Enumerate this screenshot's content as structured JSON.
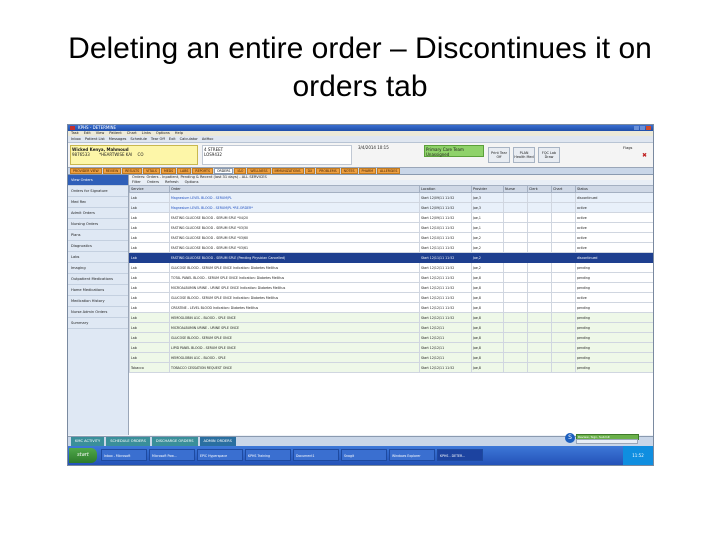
{
  "slide": {
    "title_line1": "Deleting an entire order – Discontinues it on",
    "title_line2": "orders tab"
  },
  "app": {
    "window_title": "KPHS - DETERMINE",
    "menu": [
      "Task",
      "Edit",
      "View",
      "Patient",
      "Chart",
      "Links",
      "Options",
      "Help"
    ],
    "toolbar": [
      "Inbox",
      "Patient List",
      "Messages",
      "Schedule",
      "Tear Off",
      "Exit",
      "Calculator",
      "AdHoc"
    ]
  },
  "patient": {
    "name": "Wicked Kenya, Mahmoud",
    "mrn": "9876533",
    "dob": "*HEARTWISE KAI",
    "age": "CO",
    "location": "4 STREET",
    "encounter": "LOS9432",
    "datetime": "3/4/2014 10:15",
    "allergy_alert": "Primary Care Team Unassigned",
    "buttons": [
      "Print Tear Off",
      "PLAN Health Med",
      "FQC Lab Draw"
    ],
    "flags_label": "Flags"
  },
  "nav_tabs": [
    "PROVIDER VIEW",
    "REVIEW",
    "RESULTS",
    "VITALS",
    "MEDS",
    "LABS",
    "REPORTS",
    "ORDERS",
    "I&O",
    "WELLNESS",
    "IMMUNIZATIONS",
    "DX",
    "PROBLEMS",
    "NOTES",
    "PHARM",
    "ALLERGIES"
  ],
  "active_tab": "ORDERS",
  "sidebar": [
    "View Orders",
    "Orders for Signature",
    "Med Rec",
    "Admit Orders",
    "Nursing Orders",
    "Plans",
    "Diagnostics",
    "Labs",
    "Imaging",
    "Outpatient Medications",
    "Home Medications",
    "Medication History",
    "Nurse Admin Orders",
    "Summary"
  ],
  "sidebar_selected": 0,
  "orders": {
    "filter_text": "Orders: Orders - Inpatient, Pending & Recent (last 31 days) - ALL SERVICES",
    "subtools": [
      "Filter",
      "Orders",
      "Refresh",
      "Options"
    ],
    "columns": [
      "Service",
      "Order",
      "Location",
      "Provider",
      "Nurse",
      "Clerk",
      "Chart",
      "Status"
    ],
    "rows": [
      {
        "service": "Lab",
        "order": "Magnesium LEVEL BLOOD - SERUM/PL",
        "location": "Start 12/09/11 11:52",
        "provider": "Joe,3",
        "nurse": "",
        "clerk": "",
        "chart": "",
        "status": "discontinued",
        "style": "alt"
      },
      {
        "service": "Lab",
        "order": "Magnesium LEVEL BLOOD - SERUM/PL *RE-ORDER*",
        "location": "Start 12/09/11 11:52",
        "provider": "Joe,3",
        "nurse": "",
        "clerk": "",
        "chart": "",
        "status": "active",
        "style": "alt"
      },
      {
        "service": "Lab",
        "order": "FASTING GLUCOSE BLOOD - SERUM SPLE *04/20",
        "location": "Start 12/09/11 11:52",
        "provider": "Joe,1",
        "nurse": "",
        "clerk": "",
        "chart": "",
        "status": "active",
        "style": ""
      },
      {
        "service": "Lab",
        "order": "FASTING GLUCOSE BLOOD - SERUM SPLE *03/30",
        "location": "Start 12/10/11 11:52",
        "provider": "Joe,1",
        "nurse": "",
        "clerk": "",
        "chart": "",
        "status": "active",
        "style": ""
      },
      {
        "service": "Lab",
        "order": "FASTING GLUCOSE BLOOD - SERUM SPLE *03/60",
        "location": "Start 12/10/11 11:52",
        "provider": "Joe,2",
        "nurse": "",
        "clerk": "",
        "chart": "",
        "status": "active",
        "style": ""
      },
      {
        "service": "Lab",
        "order": "FASTING GLUCOSE BLOOD - SERUM SPLE *03/61",
        "location": "Start 12/11/11 11:52",
        "provider": "Joe,2",
        "nurse": "",
        "clerk": "",
        "chart": "",
        "status": "active",
        "style": ""
      },
      {
        "service": "Lab",
        "order": "FASTING GLUCOSE BLOOD - SERUM SPLE (Pending Physician Cancelled)",
        "location": "Start 12/11/11 11:52",
        "provider": "Joe,2",
        "nurse": "",
        "clerk": "",
        "chart": "",
        "status": "discontinued",
        "style": "sel"
      },
      {
        "service": "Lab",
        "order": "GLUCOSE BLOOD - SERUM SPLE ONCE Indication: Diabetes Mellitus",
        "location": "Start 12/12/11 11:52",
        "provider": "Joe,2",
        "nurse": "",
        "clerk": "",
        "chart": "",
        "status": "pending",
        "style": ""
      },
      {
        "service": "Lab",
        "order": "TOTAL PANEL BLOOD - SERUM SPLE ONCE Indication: Diabetes Mellitus",
        "location": "Start 12/12/11 11:52",
        "provider": "Joe,8",
        "nurse": "",
        "clerk": "",
        "chart": "",
        "status": "pending",
        "style": ""
      },
      {
        "service": "Lab",
        "order": "MICROALBUMIN URINE - URINE SPLE ONCE Indication: Diabetes Mellitus",
        "location": "Start 12/12/11 11:52",
        "provider": "Joe,8",
        "nurse": "",
        "clerk": "",
        "chart": "",
        "status": "pending",
        "style": ""
      },
      {
        "service": "Lab",
        "order": "GLUCOSE BLOOD - SERUM SPLE ONCE Indication: Diabetes Mellitus",
        "location": "Start 12/12/11 11:52",
        "provider": "Joe,8",
        "nurse": "",
        "clerk": "",
        "chart": "",
        "status": "active",
        "style": ""
      },
      {
        "service": "Lab",
        "order": "CREATINE - LEVEL BLOOD Indication: Diabetes Mellitus",
        "location": "Start 12/12/11 11:52",
        "provider": "Joe,8",
        "nurse": "",
        "clerk": "",
        "chart": "",
        "status": "pending",
        "style": ""
      },
      {
        "service": "Lab",
        "order": "HEMOGLOBIN A1C - BLOOD - SPLE ONCE",
        "location": "Start 12/12/11 11:52",
        "provider": "Joe,8",
        "nurse": "",
        "clerk": "",
        "chart": "",
        "status": "pending",
        "style": "alt2"
      },
      {
        "service": "Lab",
        "order": "MICROALBUMIN URINE - URINE SPLE ONCE",
        "location": "Start 12/12/11",
        "provider": "Joe,8",
        "nurse": "",
        "clerk": "",
        "chart": "",
        "status": "pending",
        "style": "alt2"
      },
      {
        "service": "Lab",
        "order": "GLUCOSE BLOOD - SERUM SPLE ONCE",
        "location": "Start 12/12/11",
        "provider": "Joe,8",
        "nurse": "",
        "clerk": "",
        "chart": "",
        "status": "pending",
        "style": "alt2"
      },
      {
        "service": "Lab",
        "order": "LIPID PANEL BLOOD - SERUM SPLE ONCE",
        "location": "Start 12/12/11",
        "provider": "Joe,8",
        "nurse": "",
        "clerk": "",
        "chart": "",
        "status": "pending",
        "style": "alt2"
      },
      {
        "service": "Lab",
        "order": "HEMOGLOBIN A1C - BLOOD - SPLE",
        "location": "Start 12/12/11",
        "provider": "Joe,8",
        "nurse": "",
        "clerk": "",
        "chart": "",
        "status": "pending",
        "style": "alt2"
      },
      {
        "service": "Tobacco",
        "order": "TOBACCO CESSATION REQUEST ONCE",
        "location": "Start 12/12/11 11:52",
        "provider": "Joe,8",
        "nurse": "",
        "clerk": "",
        "chart": "",
        "status": "pending",
        "style": "alt2"
      }
    ]
  },
  "bottom_tabs": [
    "KMC ACTIVITY",
    "SCHEDULE ORDERS",
    "DISCHARGE ORDERS",
    "ADMIN ORDERS"
  ],
  "sign_bar_label": "Review, Sign, Submit",
  "taskbar": {
    "start": "start",
    "tasks": [
      "Inbox - Microsoft",
      "Microsoft Pow...",
      "EPIC Hyperspace",
      "KPHS Training",
      "Document1",
      "Snagit",
      "Windows Explorer",
      "KPHS - DETER..."
    ],
    "clock": "11:52"
  },
  "colors": {
    "accent": "#2f5fb8",
    "selected_row": "#1e3f8f",
    "nav_tab": "#f0a040",
    "alert": "#8fd26a"
  }
}
